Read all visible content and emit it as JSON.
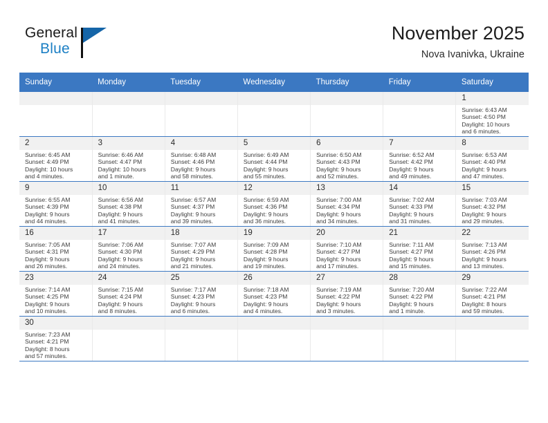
{
  "brand": {
    "name_part1": "General",
    "name_part2": "Blue"
  },
  "header": {
    "title": "November 2025",
    "location": "Nova Ivanivka, Ukraine"
  },
  "weekdays": [
    "Sunday",
    "Monday",
    "Tuesday",
    "Wednesday",
    "Thursday",
    "Friday",
    "Saturday"
  ],
  "colors": {
    "header_blue": "#3b78c2",
    "daynum_gray": "#f1f1f1",
    "brand_blue": "#1b7fc4"
  },
  "weeks": [
    [
      {
        "day": "",
        "empty": true
      },
      {
        "day": "",
        "empty": true
      },
      {
        "day": "",
        "empty": true
      },
      {
        "day": "",
        "empty": true
      },
      {
        "day": "",
        "empty": true
      },
      {
        "day": "",
        "empty": true
      },
      {
        "day": "1",
        "sunrise": "Sunrise: 6:43 AM",
        "sunset": "Sunset: 4:50 PM",
        "daylight1": "Daylight: 10 hours",
        "daylight2": "and 6 minutes."
      }
    ],
    [
      {
        "day": "2",
        "sunrise": "Sunrise: 6:45 AM",
        "sunset": "Sunset: 4:49 PM",
        "daylight1": "Daylight: 10 hours",
        "daylight2": "and 4 minutes."
      },
      {
        "day": "3",
        "sunrise": "Sunrise: 6:46 AM",
        "sunset": "Sunset: 4:47 PM",
        "daylight1": "Daylight: 10 hours",
        "daylight2": "and 1 minute."
      },
      {
        "day": "4",
        "sunrise": "Sunrise: 6:48 AM",
        "sunset": "Sunset: 4:46 PM",
        "daylight1": "Daylight: 9 hours",
        "daylight2": "and 58 minutes."
      },
      {
        "day": "5",
        "sunrise": "Sunrise: 6:49 AM",
        "sunset": "Sunset: 4:44 PM",
        "daylight1": "Daylight: 9 hours",
        "daylight2": "and 55 minutes."
      },
      {
        "day": "6",
        "sunrise": "Sunrise: 6:50 AM",
        "sunset": "Sunset: 4:43 PM",
        "daylight1": "Daylight: 9 hours",
        "daylight2": "and 52 minutes."
      },
      {
        "day": "7",
        "sunrise": "Sunrise: 6:52 AM",
        "sunset": "Sunset: 4:42 PM",
        "daylight1": "Daylight: 9 hours",
        "daylight2": "and 49 minutes."
      },
      {
        "day": "8",
        "sunrise": "Sunrise: 6:53 AM",
        "sunset": "Sunset: 4:40 PM",
        "daylight1": "Daylight: 9 hours",
        "daylight2": "and 47 minutes."
      }
    ],
    [
      {
        "day": "9",
        "sunrise": "Sunrise: 6:55 AM",
        "sunset": "Sunset: 4:39 PM",
        "daylight1": "Daylight: 9 hours",
        "daylight2": "and 44 minutes."
      },
      {
        "day": "10",
        "sunrise": "Sunrise: 6:56 AM",
        "sunset": "Sunset: 4:38 PM",
        "daylight1": "Daylight: 9 hours",
        "daylight2": "and 41 minutes."
      },
      {
        "day": "11",
        "sunrise": "Sunrise: 6:57 AM",
        "sunset": "Sunset: 4:37 PM",
        "daylight1": "Daylight: 9 hours",
        "daylight2": "and 39 minutes."
      },
      {
        "day": "12",
        "sunrise": "Sunrise: 6:59 AM",
        "sunset": "Sunset: 4:36 PM",
        "daylight1": "Daylight: 9 hours",
        "daylight2": "and 36 minutes."
      },
      {
        "day": "13",
        "sunrise": "Sunrise: 7:00 AM",
        "sunset": "Sunset: 4:34 PM",
        "daylight1": "Daylight: 9 hours",
        "daylight2": "and 34 minutes."
      },
      {
        "day": "14",
        "sunrise": "Sunrise: 7:02 AM",
        "sunset": "Sunset: 4:33 PM",
        "daylight1": "Daylight: 9 hours",
        "daylight2": "and 31 minutes."
      },
      {
        "day": "15",
        "sunrise": "Sunrise: 7:03 AM",
        "sunset": "Sunset: 4:32 PM",
        "daylight1": "Daylight: 9 hours",
        "daylight2": "and 29 minutes."
      }
    ],
    [
      {
        "day": "16",
        "sunrise": "Sunrise: 7:05 AM",
        "sunset": "Sunset: 4:31 PM",
        "daylight1": "Daylight: 9 hours",
        "daylight2": "and 26 minutes."
      },
      {
        "day": "17",
        "sunrise": "Sunrise: 7:06 AM",
        "sunset": "Sunset: 4:30 PM",
        "daylight1": "Daylight: 9 hours",
        "daylight2": "and 24 minutes."
      },
      {
        "day": "18",
        "sunrise": "Sunrise: 7:07 AM",
        "sunset": "Sunset: 4:29 PM",
        "daylight1": "Daylight: 9 hours",
        "daylight2": "and 21 minutes."
      },
      {
        "day": "19",
        "sunrise": "Sunrise: 7:09 AM",
        "sunset": "Sunset: 4:28 PM",
        "daylight1": "Daylight: 9 hours",
        "daylight2": "and 19 minutes."
      },
      {
        "day": "20",
        "sunrise": "Sunrise: 7:10 AM",
        "sunset": "Sunset: 4:27 PM",
        "daylight1": "Daylight: 9 hours",
        "daylight2": "and 17 minutes."
      },
      {
        "day": "21",
        "sunrise": "Sunrise: 7:11 AM",
        "sunset": "Sunset: 4:27 PM",
        "daylight1": "Daylight: 9 hours",
        "daylight2": "and 15 minutes."
      },
      {
        "day": "22",
        "sunrise": "Sunrise: 7:13 AM",
        "sunset": "Sunset: 4:26 PM",
        "daylight1": "Daylight: 9 hours",
        "daylight2": "and 13 minutes."
      }
    ],
    [
      {
        "day": "23",
        "sunrise": "Sunrise: 7:14 AM",
        "sunset": "Sunset: 4:25 PM",
        "daylight1": "Daylight: 9 hours",
        "daylight2": "and 10 minutes."
      },
      {
        "day": "24",
        "sunrise": "Sunrise: 7:15 AM",
        "sunset": "Sunset: 4:24 PM",
        "daylight1": "Daylight: 9 hours",
        "daylight2": "and 8 minutes."
      },
      {
        "day": "25",
        "sunrise": "Sunrise: 7:17 AM",
        "sunset": "Sunset: 4:23 PM",
        "daylight1": "Daylight: 9 hours",
        "daylight2": "and 6 minutes."
      },
      {
        "day": "26",
        "sunrise": "Sunrise: 7:18 AM",
        "sunset": "Sunset: 4:23 PM",
        "daylight1": "Daylight: 9 hours",
        "daylight2": "and 4 minutes."
      },
      {
        "day": "27",
        "sunrise": "Sunrise: 7:19 AM",
        "sunset": "Sunset: 4:22 PM",
        "daylight1": "Daylight: 9 hours",
        "daylight2": "and 3 minutes."
      },
      {
        "day": "28",
        "sunrise": "Sunrise: 7:20 AM",
        "sunset": "Sunset: 4:22 PM",
        "daylight1": "Daylight: 9 hours",
        "daylight2": "and 1 minute."
      },
      {
        "day": "29",
        "sunrise": "Sunrise: 7:22 AM",
        "sunset": "Sunset: 4:21 PM",
        "daylight1": "Daylight: 8 hours",
        "daylight2": "and 59 minutes."
      }
    ],
    [
      {
        "day": "30",
        "sunrise": "Sunrise: 7:23 AM",
        "sunset": "Sunset: 4:21 PM",
        "daylight1": "Daylight: 8 hours",
        "daylight2": "and 57 minutes."
      },
      {
        "day": "",
        "empty": true
      },
      {
        "day": "",
        "empty": true
      },
      {
        "day": "",
        "empty": true
      },
      {
        "day": "",
        "empty": true
      },
      {
        "day": "",
        "empty": true
      },
      {
        "day": "",
        "empty": true
      }
    ]
  ]
}
